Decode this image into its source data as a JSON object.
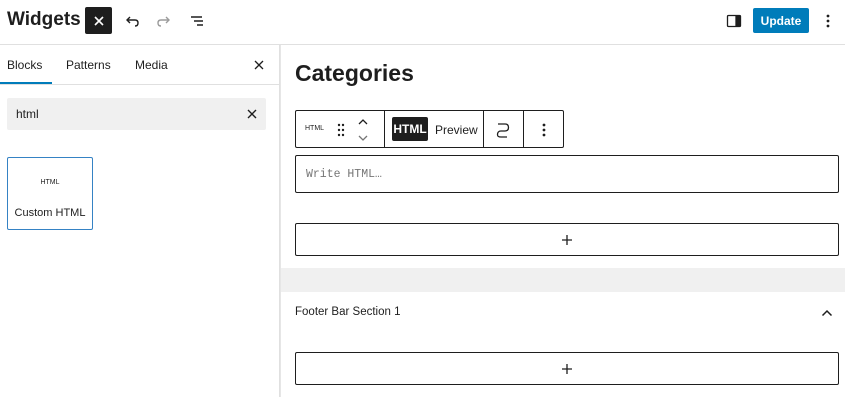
{
  "header": {
    "title": "Widgets",
    "update_label": "Update"
  },
  "inserter": {
    "tabs": [
      "Blocks",
      "Patterns",
      "Media"
    ],
    "active_tab": "Blocks",
    "search": {
      "value": "html"
    },
    "results": [
      {
        "icon_text": "HTML",
        "label": "Custom HTML"
      }
    ]
  },
  "canvas": {
    "heading": "Categories",
    "toolbar": {
      "block_icon_text": "HTML",
      "html_label": "HTML",
      "preview_label": "Preview"
    },
    "html_block": {
      "placeholder": "Write HTML…"
    },
    "section": {
      "title": "Footer Bar Section 1"
    }
  },
  "colors": {
    "accent": "#007cba",
    "dark": "#1e1e1e",
    "selected_border": "#3582c4",
    "band": "#f0f0f0"
  }
}
